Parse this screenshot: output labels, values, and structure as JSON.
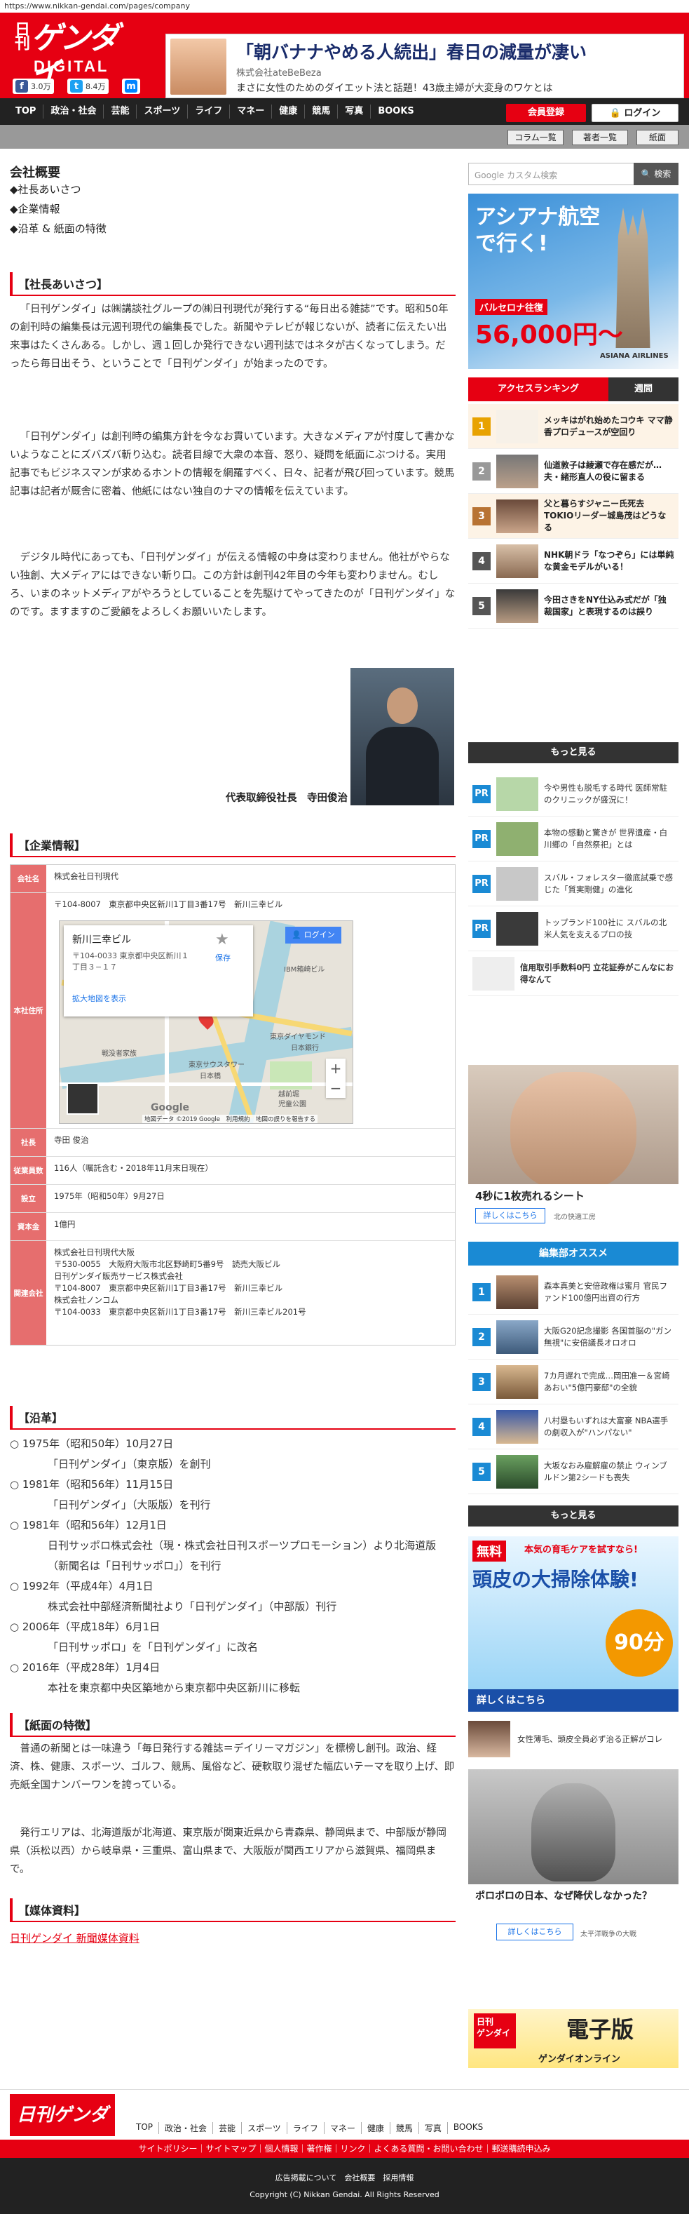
{
  "url": "https://www.nikkan-gendai.com/pages/company",
  "header": {
    "logo_small": "日刊",
    "logo_main": "ゲンダイ",
    "logo_sub": "DIGITAL",
    "facebook_count": "3.0万",
    "twitter_count": "8.4万",
    "ad_title": "「朝バナナやめる人続出」春日の減量が凄い",
    "ad_sponsor": "株式会社ateBeBeza",
    "ad_desc": "まさに女性のためのダイエット法と話題！43歳主婦が大変身のワケとは"
  },
  "nav": {
    "items": [
      "TOP",
      "政治・社会",
      "芸能",
      "スポーツ",
      "ライフ",
      "マネー",
      "健康",
      "競馬",
      "写真",
      "BOOKS"
    ],
    "register": "会員登録",
    "login": "ログイン",
    "sub": [
      "コラム一覧",
      "著者一覧",
      "紙面"
    ]
  },
  "main": {
    "title": "会社概要",
    "toc": [
      "◆社長あいさつ",
      "◆企業情報",
      "◆沿革 & 紙面の特徴"
    ],
    "greeting_head": "【社長あいさつ】",
    "greeting_p1": "「日刊ゲンダイ」は㈱講談社グループの㈱日刊現代が発行する“毎日出る雑誌”です。昭和50年の創刊時の編集長は元週刊現代の編集長でした。新聞やテレビが報じないが、読者に伝えたい出来事はたくさんある。しかし、週１回しか発行できない週刊誌ではネタが古くなってしまう。だったら毎日出そう、ということで「日刊ゲンダイ」が始まったのです。",
    "greeting_p2": "「日刊ゲンダイ」は創刊時の編集方針を今なお貫いています。大きなメディアが忖度して書かないようなことにズバズバ斬り込む。読者目線で大衆の本音、怒り、疑問を紙面にぶつける。実用記事でもビジネスマンが求めるホントの情報を網羅すべく、日々、記者が飛び回っています。競馬記事は記者が厩舎に密着、他紙にはない独自のナマの情報を伝えています。",
    "greeting_p3": "デジタル時代にあっても、「日刊ゲンダイ」が伝える情報の中身は変わりません。他社がやらない独創、大メディアにはできない斬り口。この方針は創刊42年目の今年も変わりません。むしろ、いまのネットメディアがやろうとしていることを先駆けてやってきたのが「日刊ゲンダイ」なのです。ますますのご愛顧をよろしくお願いいたします。",
    "president": "代表取締役社長　寺田俊治",
    "company_head": "【企業情報】",
    "company_rows": [
      {
        "label": "会社名",
        "value": "株式会社日刊現代"
      },
      {
        "label": "本社住所",
        "value": "〒104-8007　東京都中央区新川1丁目3番17号　新川三幸ビル"
      },
      {
        "label": "社長",
        "value": "寺田 俊治"
      },
      {
        "label": "従業員数",
        "value": "116人（嘱託含む・2018年11月末日現在）"
      },
      {
        "label": "設立",
        "value": "1975年（昭和50年）9月27日"
      },
      {
        "label": "資本金",
        "value": "1億円"
      },
      {
        "label": "関連会社",
        "value": "株式会社日刊現代大阪\n〒530-0055　大阪府大阪市北区野崎町5番9号　読売大阪ビル\n日刊ゲンダイ販売サービス株式会社\n〒104-8007　東京都中央区新川1丁目3番17号　新川三幸ビル\n株式会社ノンコム\n〒104-0033　東京都中央区新川1丁目3番17号　新川三幸ビル201号"
      }
    ],
    "map": {
      "place_name": "新川三幸ビル",
      "place_addr": "〒104-0033 東京都中央区新川１丁目３−１７",
      "save": "保存",
      "larger": "拡大地図を表示",
      "login": "ログイン",
      "labels": [
        "IBM箱崎ビル",
        "日本銀行",
        "東京ダイヤモンド",
        "戦没者家族",
        "東京サウスタワー",
        "日本橋",
        "越前堀",
        "児童公園"
      ],
      "footer": "地図データ ©2019 Google　利用規約　地図の誤りを報告する",
      "brand": "Google"
    },
    "history_head": "【沿革】",
    "history": [
      {
        "date": "○ 1975年（昭和50年）10月27日",
        "desc": "「日刊ゲンダイ」（東京版）を創刊"
      },
      {
        "date": "○ 1981年（昭和56年）11月15日",
        "desc": "「日刊ゲンダイ」（大阪版）を刊行"
      },
      {
        "date": "○ 1981年（昭和56年）12月1日",
        "desc": "日刊サッポロ株式会社（現・株式会社日刊スポーツプロモーション）より北海道版（新聞名は「日刊サッポロ」）を刊行"
      },
      {
        "date": "○ 1992年（平成4年）4月1日",
        "desc": "株式会社中部経済新聞社より「日刊ゲンダイ」（中部版）刊行"
      },
      {
        "date": "○ 2006年（平成18年）6月1日",
        "desc": "「日刊サッポロ」を「日刊ゲンダイ」に改名"
      },
      {
        "date": "○ 2016年（平成28年）1月4日",
        "desc": "本社を東京都中央区築地から東京都中央区新川に移転"
      }
    ],
    "feature_head": "【紙面の特徴】",
    "feature_p1": "普通の新聞とは一味違う「毎日発行する雑誌＝デイリーマガジン」を標榜し創刊。政治、経済、株、健康、スポーツ、ゴルフ、競馬、風俗など、硬軟取り混ぜた幅広いテーマを取り上げ、即売紙全国ナンバーワンを誇っている。",
    "feature_p2": "発行エリアは、北海道版が北海道、東京版が関東近県から青森県、静岡県まで、中部版が静岡県（浜松以西）から岐阜県・三重県、富山県まで、大阪版が関西エリアから滋賀県、福岡県まで。",
    "media_head": "【媒体資料】",
    "media_link": "日刊ゲンダイ 新聞媒体資料"
  },
  "sidebar": {
    "search_placeholder": "Google カスタム検索",
    "search_button": "検索",
    "ad_air": {
      "line1": "アシアナ航空",
      "line2": "で行く!",
      "dest": "バルセロナ往復",
      "price": "56,000円～",
      "brand": "ASIANA AIRLINES"
    },
    "ranking_tab": "アクセスランキング",
    "ranking_tab2": "週間",
    "ranking": [
      {
        "num": "1",
        "text": "メッキはがれ始めたコウキ ママ静香プロデュースが空回り"
      },
      {
        "num": "2",
        "text": "仙道敦子は綾瀬で存在感だが…夫・緒形直人の役に留まる"
      },
      {
        "num": "3",
        "text": "父と暮らすジャニー氏死去 TOKIOリーダー城島茂はどうなる"
      },
      {
        "num": "4",
        "text": "NHK朝ドラ「なつぞら」には単純な黄金モデルがいる！"
      },
      {
        "num": "5",
        "text": "今田さきをNY仕込み式だが「独裁国家」と表現するのは誤り"
      }
    ],
    "more": "もっと見る",
    "pr": [
      {
        "text": "今や男性も脱毛する時代 医師常駐のクリニックが盛況に！"
      },
      {
        "text": "本物の感動と驚きが 世界遺産・白川郷の「自然祭祀」とは"
      },
      {
        "text": "スバル・フォレスター徹底試乗で感じた「質実剛健」の進化"
      },
      {
        "text": "トップランド100社に スバルの北米人気を支えるプロの技"
      },
      {
        "text": "信用取引手数料0円 立花証券がこんなにお得なんて"
      }
    ],
    "ad_face": {
      "title": "4秒に1枚売れるシート",
      "button": "詳しくはこちら",
      "brand": "北の快適工房"
    },
    "editor_head": "編集部オススメ",
    "editor": [
      {
        "num": "1",
        "text": "森本真美と安倍政権は蜜月 官民ファンド100億円出資の行方"
      },
      {
        "num": "2",
        "text": "大阪G20記念撮影 各国首脳の\"ガン無視\"に安倍議長オロオロ"
      },
      {
        "num": "3",
        "text": "7カ月遅れで完成…岡田准一＆宮崎あおい\"5億円豪邸\"の全貌"
      },
      {
        "num": "4",
        "text": "八村塁もいずれは大富豪 NBA選手の劇収入が\"ハンパない\""
      },
      {
        "num": "5",
        "text": "大坂なおみ雇解雇の禁止 ウィンブルドン第2シードも喪失"
      }
    ],
    "ad_hair": {
      "tag": "無料",
      "line": "本気の育毛ケアを試すなら!",
      "big": "頭皮の大掃除体験!",
      "sec": "90分",
      "button": "詳しくはこちら"
    },
    "ad_hair_caption": "女性薄毛、頭皮全員必ず治る正解がコレ",
    "ad_war": {
      "title": "ポロポロの日本、なぜ降伏しなかった？",
      "button": "詳しくはこちら",
      "brand": "太平洋戦争の大戦"
    },
    "epaper": {
      "line1": "日刊",
      "line2": "ゲンダイ",
      "line3": "電子版",
      "sub": "ゲンダイオンライン"
    }
  },
  "footer": {
    "nav": [
      "TOP",
      "政治・社会",
      "芸能",
      "スポーツ",
      "ライフ",
      "マネー",
      "健康",
      "競馬",
      "写真",
      "BOOKS"
    ],
    "links": "サイトポリシー｜サイトマップ｜個人情報｜著作権｜リンク｜よくある質問・お問い合わせ｜郵送購読申込み",
    "links2": "広告掲載について　会社概要　採用情報",
    "copyright": "Copyright (C) Nikkan Gendai. All Rights Reserved"
  }
}
